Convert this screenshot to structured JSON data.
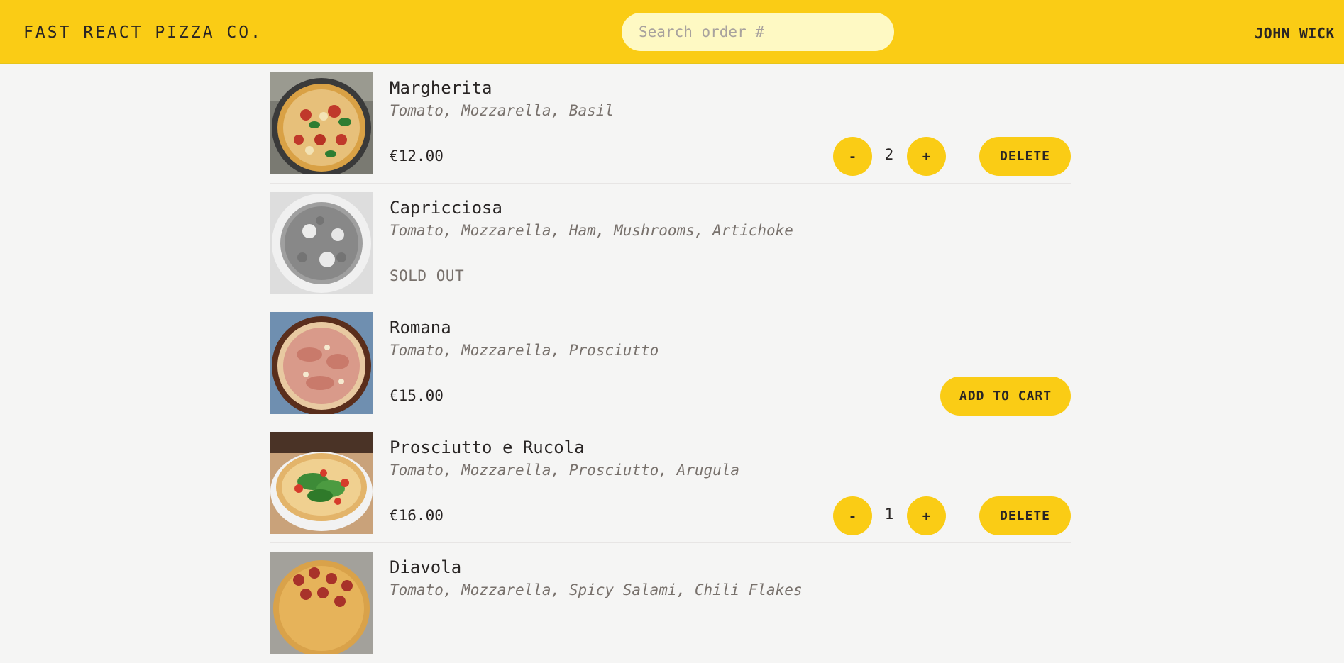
{
  "header": {
    "logo": "FAST REACT PIZZA CO.",
    "search_placeholder": "Search order #",
    "search_value": "",
    "username": "JOHN WICK"
  },
  "colors": {
    "accent": "#facc15",
    "search_bg": "#fef9c3",
    "page_bg": "#f5f5f4",
    "text": "#292524",
    "muted": "#78716c"
  },
  "menu": [
    {
      "name": "Margherita",
      "ingredients": "Tomato, Mozzarella, Basil",
      "price": "€12.00",
      "sold_out": false,
      "in_cart": true,
      "quantity": "2",
      "minus_label": "-",
      "plus_label": "+",
      "delete_label": "DELETE",
      "image_icon": "pizza-margherita-photo"
    },
    {
      "name": "Capricciosa",
      "ingredients": "Tomato, Mozzarella, Ham, Mushrooms, Artichoke",
      "sold_out_label": "SOLD OUT",
      "sold_out": true,
      "image_icon": "pizza-capricciosa-photo"
    },
    {
      "name": "Romana",
      "ingredients": "Tomato, Mozzarella, Prosciutto",
      "price": "€15.00",
      "sold_out": false,
      "in_cart": false,
      "add_label": "ADD TO CART",
      "image_icon": "pizza-romana-photo"
    },
    {
      "name": "Prosciutto e Rucola",
      "ingredients": "Tomato, Mozzarella, Prosciutto, Arugula",
      "price": "€16.00",
      "sold_out": false,
      "in_cart": true,
      "quantity": "1",
      "minus_label": "-",
      "plus_label": "+",
      "delete_label": "DELETE",
      "image_icon": "pizza-prosciutto-rucola-photo"
    },
    {
      "name": "Diavola",
      "ingredients": "Tomato, Mozzarella, Spicy Salami, Chili Flakes",
      "image_icon": "pizza-diavola-photo"
    }
  ]
}
